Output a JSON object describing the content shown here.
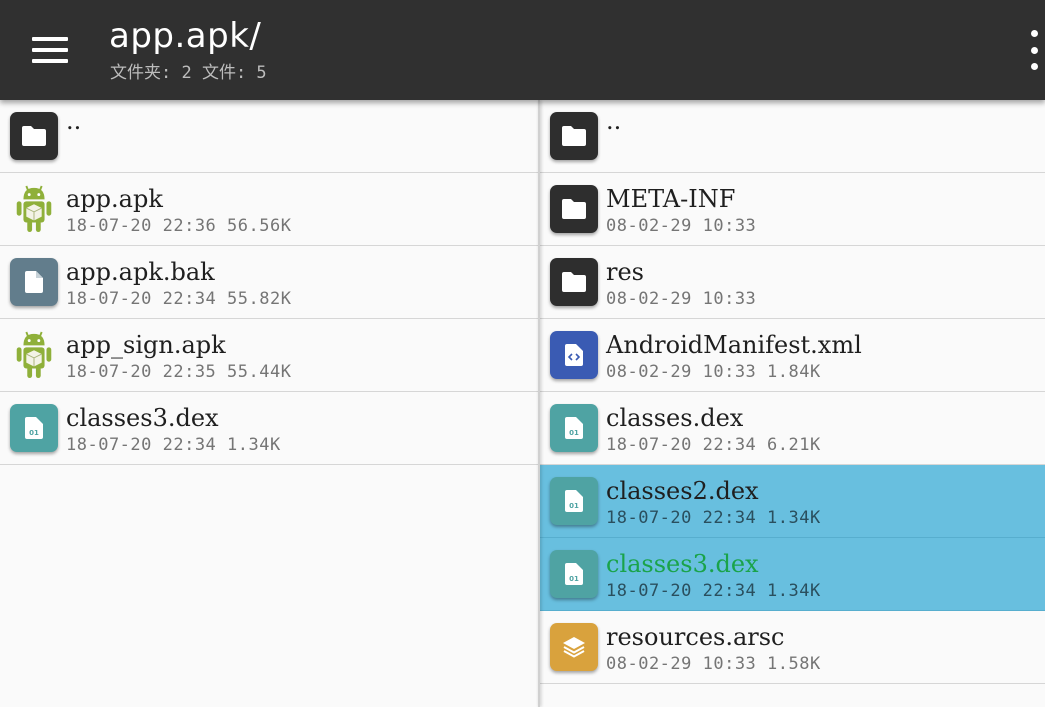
{
  "toolbar": {
    "title": "app.apk/",
    "subtitle": "文件夹: 2  文件: 5"
  },
  "icons": {
    "menu": "menu-icon",
    "more": "more-vert-icon",
    "folder": "folder-icon",
    "file": "file-icon",
    "dex": "dex-file-icon",
    "xml": "xml-code-icon",
    "arsc": "layers-icon",
    "apk": "android-icon"
  },
  "colors": {
    "toolbar": "#303030",
    "selected_row": "#68bfdf",
    "highlight_text": "#1aa34a"
  },
  "left_pane": {
    "items": [
      {
        "name": "..",
        "meta": "",
        "type": "folder"
      },
      {
        "name": "app.apk",
        "meta": "18-07-20 22:36  56.56K",
        "type": "apk"
      },
      {
        "name": "app.apk.bak",
        "meta": "18-07-20 22:34  55.82K",
        "type": "file"
      },
      {
        "name": "app_sign.apk",
        "meta": "18-07-20 22:35  55.44K",
        "type": "apk"
      },
      {
        "name": "classes3.dex",
        "meta": "18-07-20 22:34  1.34K",
        "type": "dex"
      }
    ]
  },
  "right_pane": {
    "items": [
      {
        "name": "..",
        "meta": "",
        "type": "folder"
      },
      {
        "name": "META-INF",
        "meta": "08-02-29 10:33",
        "type": "folder"
      },
      {
        "name": "res",
        "meta": "08-02-29 10:33",
        "type": "folder"
      },
      {
        "name": "AndroidManifest.xml",
        "meta": "08-02-29 10:33  1.84K",
        "type": "xml"
      },
      {
        "name": "classes.dex",
        "meta": "18-07-20 22:34  6.21K",
        "type": "dex"
      },
      {
        "name": "classes2.dex",
        "meta": "18-07-20 22:34  1.34K",
        "type": "dex",
        "selected": true
      },
      {
        "name": "classes3.dex",
        "meta": "18-07-20 22:34  1.34K",
        "type": "dex",
        "selected": true,
        "highlight": true
      },
      {
        "name": "resources.arsc",
        "meta": "08-02-29 10:33  1.58K",
        "type": "arsc"
      }
    ]
  }
}
